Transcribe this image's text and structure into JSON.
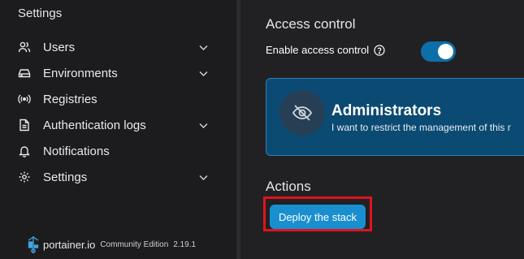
{
  "sidebar": {
    "title": "Settings",
    "items": [
      {
        "label": "Users",
        "icon": "users-icon",
        "has_chevron": true
      },
      {
        "label": "Environments",
        "icon": "environments-icon",
        "has_chevron": true
      },
      {
        "label": "Registries",
        "icon": "registries-icon",
        "has_chevron": false
      },
      {
        "label": "Authentication logs",
        "icon": "document-icon",
        "has_chevron": true
      },
      {
        "label": "Notifications",
        "icon": "bell-icon",
        "has_chevron": false
      },
      {
        "label": "Settings",
        "icon": "gear-icon",
        "has_chevron": true
      }
    ],
    "footer": {
      "brand": "portainer.io",
      "edition": "Community Edition",
      "version": "2.19.1"
    }
  },
  "main": {
    "section_title": "Access control",
    "access_control_label": "Enable access control",
    "access_control_enabled": true,
    "card": {
      "title": "Administrators",
      "description": "I want to restrict the management of this r"
    },
    "actions_title": "Actions",
    "deploy_button": "Deploy the stack"
  },
  "colors": {
    "accent": "#1a8fd0",
    "toggle_on": "#0d6ea8",
    "card_bg": "#0b4a73",
    "highlight": "#e0141b"
  }
}
